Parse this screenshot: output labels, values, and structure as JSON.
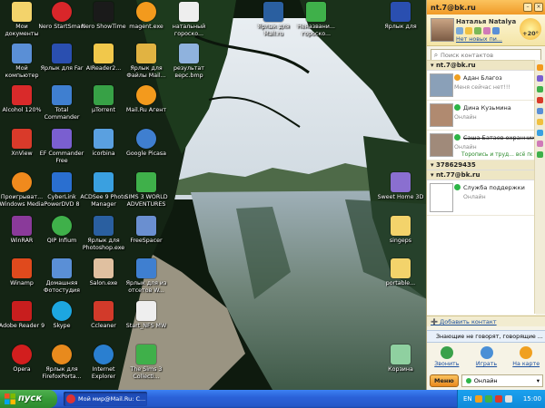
{
  "desktop_icons": [
    {
      "label": "Мои документы",
      "color": "#f3d36b"
    },
    {
      "label": "Nero StartSmart",
      "color": "#d9262a"
    },
    {
      "label": "Nero ShowTime",
      "color": "#1a1a1a"
    },
    {
      "label": "magent.exe",
      "color": "#f39a1d"
    },
    {
      "label": "натальный гороско...",
      "color": "#eeeeee"
    },
    {
      "label": "Мой компьютер",
      "color": "#5a8fd6"
    },
    {
      "label": "Ярлык для Far",
      "color": "#2a4fb0"
    },
    {
      "label": "AIReader2...",
      "color": "#f1c84b"
    },
    {
      "label": "Ярлык для Файлы Mail...",
      "color": "#e1b342"
    },
    {
      "label": "результат верс.bmp",
      "color": "#8fb2dd"
    },
    {
      "label": "Alcohol 120%",
      "color": "#d92a2a"
    },
    {
      "label": "Total Commander",
      "color": "#3f7fd0"
    },
    {
      "label": "µTorrent",
      "color": "#37a146"
    },
    {
      "label": "Mail.Ru Агент",
      "color": "#f39a1d"
    },
    {
      "label": "XnView",
      "color": "#d93a2a"
    },
    {
      "label": "EF Commander Free",
      "color": "#7a5fd0"
    },
    {
      "label": "icorbina",
      "color": "#5aa0e0"
    },
    {
      "label": "Google Picasa",
      "color": "#3f7fd0"
    },
    {
      "label": "Проигрыват... Windows Media",
      "color": "#f08a1d"
    },
    {
      "label": "CyberLink PowerDVD 8",
      "color": "#2a6fd0"
    },
    {
      "label": "ACDSee 9 Photo Manager",
      "color": "#3aa0e0"
    },
    {
      "label": "SIMS 3 WORLD ADVENTURES",
      "color": "#3fb04a"
    },
    {
      "label": "WinRAR",
      "color": "#8a3a9a"
    },
    {
      "label": "QIP Infium",
      "color": "#3fb04a"
    },
    {
      "label": "Ярлык для Photoshop.exe",
      "color": "#2a5fa0"
    },
    {
      "label": "FreeSpacer",
      "color": "#6a8fd0"
    },
    {
      "label": "Winamp",
      "color": "#e04a1d"
    },
    {
      "label": "Домашняя Фотостудия",
      "color": "#5a8fd6"
    },
    {
      "label": "Salon.exe",
      "color": "#e0c0a0"
    },
    {
      "label": "Ярлык для из отсетов W...",
      "color": "#3f7fd0"
    },
    {
      "label": "Adobe Reader 9",
      "color": "#c81e1e"
    },
    {
      "label": "Skype",
      "color": "#1da6e0"
    },
    {
      "label": "Ccleaner",
      "color": "#d23a2a"
    },
    {
      "label": "Start_NFS MW",
      "color": "#eeeeee"
    },
    {
      "label": "Opera",
      "color": "#d21e1e"
    },
    {
      "label": "Ярлык для FirefoxPorta...",
      "color": "#e88a1d"
    },
    {
      "label": "Internet Explorer",
      "color": "#2a7fd0"
    },
    {
      "label": "The Sims 3 Collecti...",
      "color": "#3fb04a"
    },
    {
      "label": "Ярлык для Mail.ru",
      "color": "#2a5fa0"
    },
    {
      "label": "Неназвани... гороско...",
      "color": "#3fb04a"
    },
    {
      "label": "Ярлык для",
      "color": "#2a4fb0"
    },
    {
      "label": "Sweet Home 3D",
      "color": "#8a6fd0"
    },
    {
      "label": "singeps",
      "color": "#f3d36b"
    },
    {
      "label": "portable...",
      "color": "#f3d36b"
    },
    {
      "label": "Корзина",
      "color": "#8fd0a0"
    }
  ],
  "agent": {
    "title": "nt.7@bk.ru",
    "profile_name": "Наталья Natalya",
    "profile_mail": "Нет новых пи...",
    "weather": "+20°",
    "search_placeholder": "Поиск контактов",
    "groups": [
      {
        "name": "nt.7@bk.ru",
        "contacts": [
          {
            "name": "Адан Благоз",
            "status": "Меня сейчас нет!!!",
            "extra": "",
            "avatar": "#8aa0b8"
          },
          {
            "name": "Дина Кузьмина",
            "status": "Онлайн",
            "extra": "",
            "avatar": "#b08a70"
          },
          {
            "name": "Саша Батаев охранник",
            "status": "Онлайн",
            "extra": "Торопись и труд... всё пол...",
            "avatar": "#a08a7a"
          }
        ]
      },
      {
        "name": "378629435",
        "contacts": []
      },
      {
        "name": "nt.77@bk.ru",
        "contacts": [
          {
            "name": "Служба поддержки",
            "status": "Онлайн",
            "extra": "",
            "avatar": "#ffffff"
          }
        ]
      }
    ],
    "add_contact": "Добавить контакт",
    "ticker": "Знающие не говорят, говорящие ...",
    "actions": [
      {
        "label": "Звонить",
        "color": "#3aa14a"
      },
      {
        "label": "Играть",
        "color": "#4a8fd6"
      },
      {
        "label": "На карте",
        "color": "#f0a020"
      }
    ],
    "menu_label": "Меню",
    "status_label": "Онлайн"
  },
  "taskbar": {
    "start_label": "пуск",
    "task_item": "Мой мир@Mail.Ru: С...",
    "lang": "EN",
    "clock": "15:00"
  }
}
